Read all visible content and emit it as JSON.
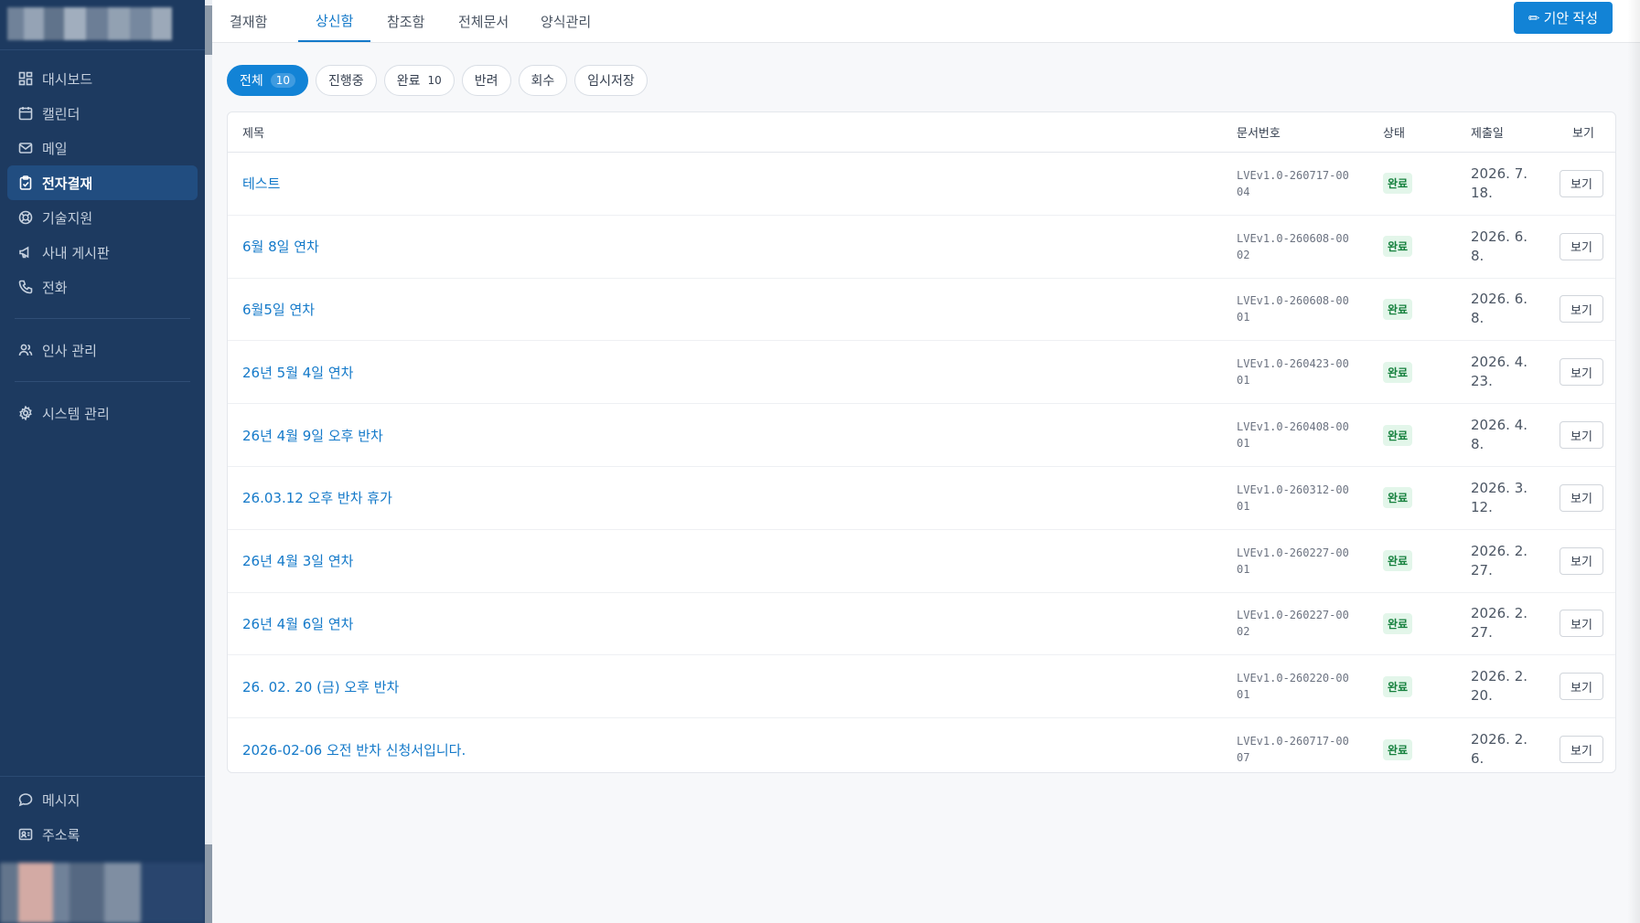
{
  "sidebar": {
    "items": [
      {
        "label": "대시보드",
        "icon": "dashboard-icon",
        "active": false
      },
      {
        "label": "캘린더",
        "icon": "calendar-icon",
        "active": false
      },
      {
        "label": "메일",
        "icon": "mail-icon",
        "active": false
      },
      {
        "label": "전자결재",
        "icon": "clipboard-icon",
        "active": true
      },
      {
        "label": "기술지원",
        "icon": "lifebuoy-icon",
        "active": false
      },
      {
        "label": "사내 게시판",
        "icon": "megaphone-icon",
        "active": false
      },
      {
        "label": "전화",
        "icon": "phone-icon",
        "active": false
      }
    ],
    "admin_items": [
      {
        "label": "인사 관리",
        "icon": "users-icon"
      },
      {
        "label": "시스템 관리",
        "icon": "gear-icon"
      }
    ],
    "bottom_items": [
      {
        "label": "메시지",
        "icon": "message-icon"
      },
      {
        "label": "주소록",
        "icon": "contact-card-icon"
      }
    ]
  },
  "topbar": {
    "tabs": [
      "결재함",
      "상신함",
      "참조함",
      "전체문서",
      "양식관리"
    ],
    "active_tab": "상신함",
    "create_button": "✏ 기안 작성"
  },
  "filters": [
    {
      "label": "전체",
      "count": "10",
      "active": true
    },
    {
      "label": "진행중",
      "count": "",
      "active": false
    },
    {
      "label": "완료",
      "count": "10",
      "active": false
    },
    {
      "label": "반려",
      "count": "",
      "active": false
    },
    {
      "label": "회수",
      "count": "",
      "active": false
    },
    {
      "label": "임시저장",
      "count": "",
      "active": false
    }
  ],
  "table": {
    "headers": {
      "title": "제목",
      "doc_no": "문서번호",
      "status": "상태",
      "date": "제출일",
      "view": "보기"
    },
    "rows": [
      {
        "title": "테스트",
        "doc_no": "LVEv1.0-260717-0004",
        "status": "완료",
        "date": "2026. 7. 18.",
        "view": "보기"
      },
      {
        "title": "6월 8일 연차",
        "doc_no": "LVEv1.0-260608-0002",
        "status": "완료",
        "date": "2026. 6. 8.",
        "view": "보기"
      },
      {
        "title": "6월5일 연차",
        "doc_no": "LVEv1.0-260608-0001",
        "status": "완료",
        "date": "2026. 6. 8.",
        "view": "보기"
      },
      {
        "title": "26년 5월 4일 연차",
        "doc_no": "LVEv1.0-260423-0001",
        "status": "완료",
        "date": "2026. 4. 23.",
        "view": "보기"
      },
      {
        "title": "26년 4월 9일 오후 반차",
        "doc_no": "LVEv1.0-260408-0001",
        "status": "완료",
        "date": "2026. 4. 8.",
        "view": "보기"
      },
      {
        "title": "26.03.12 오후 반차 휴가",
        "doc_no": "LVEv1.0-260312-0001",
        "status": "완료",
        "date": "2026. 3. 12.",
        "view": "보기"
      },
      {
        "title": "26년 4월 3일 연차",
        "doc_no": "LVEv1.0-260227-0001",
        "status": "완료",
        "date": "2026. 2. 27.",
        "view": "보기"
      },
      {
        "title": "26년 4월 6일 연차",
        "doc_no": "LVEv1.0-260227-0002",
        "status": "완료",
        "date": "2026. 2. 27.",
        "view": "보기"
      },
      {
        "title": "26. 02. 20 (금) 오후 반차",
        "doc_no": "LVEv1.0-260220-0001",
        "status": "완료",
        "date": "2026. 2. 20.",
        "view": "보기"
      },
      {
        "title": "2026-02-06 오전 반차 신청서입니다.",
        "doc_no": "LVEv1.0-260717-0007",
        "status": "완료",
        "date": "2026. 2. 6.",
        "view": "보기"
      }
    ]
  },
  "colors": {
    "sidebar_bg": "#1d3a60",
    "accent": "#1283d6",
    "status_done_bg": "#e3f6ea",
    "status_done_fg": "#15803d"
  }
}
